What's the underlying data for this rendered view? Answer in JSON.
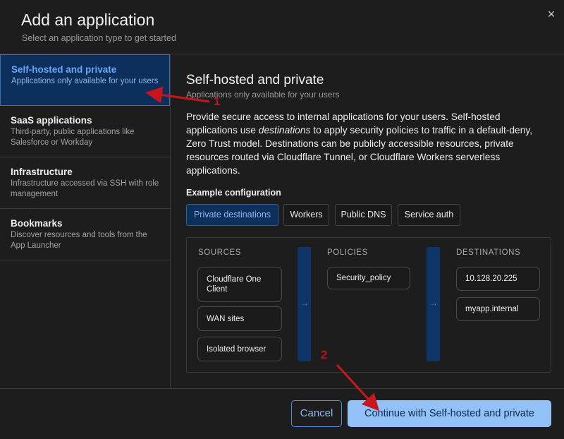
{
  "header": {
    "title": "Add an application",
    "subtitle": "Select an application type to get started",
    "close_icon": "×"
  },
  "sidebar": {
    "items": [
      {
        "name": "Self-hosted and private",
        "desc": "Applications only available for your users",
        "active": true
      },
      {
        "name": "SaaS applications",
        "desc": "Third-party, public applications like Salesforce or Workday"
      },
      {
        "name": "Infrastructure",
        "desc": "Infrastructure accessed via SSH with role management"
      },
      {
        "name": "Bookmarks",
        "desc": "Discover resources and tools from the App Launcher"
      }
    ]
  },
  "main": {
    "title": "Self-hosted and private",
    "subtitle": "Applications only available for your users",
    "desc_parts": [
      "Provide secure access to internal applications for your users. Self-hosted applications use ",
      "destinations",
      " to apply security policies to traffic in a default-deny, Zero Trust model. Destinations can be publicly accessible resources, private resources routed via Cloudflare Tunnel, or Cloudflare Workers serverless applications."
    ],
    "example_label": "Example configuration",
    "tabs": [
      "Private destinations",
      "Workers",
      "Public DNS",
      "Service auth"
    ],
    "active_tab": 0
  },
  "diagram": {
    "sources_header": "SOURCES",
    "policies_header": "POLICIES",
    "destinations_header": "DESTINATIONS",
    "sources": [
      "Cloudflare One Client",
      "WAN sites",
      "Isolated browser"
    ],
    "policies": [
      "Security_policy"
    ],
    "destinations": [
      "10.128.20.225",
      "myapp.internal"
    ],
    "pipe_arrow": "→"
  },
  "footer": {
    "cancel_label": "Cancel",
    "continue_label": "Continue with Self-hosted and private"
  },
  "annotations": {
    "label_1": "1",
    "label_2": "2",
    "arrow_color": "#c8161d"
  },
  "colors": {
    "accent_active_bg": "#0c2f5c",
    "accent_text": "#6aa6f5",
    "primary_button": "#92c1f7"
  }
}
